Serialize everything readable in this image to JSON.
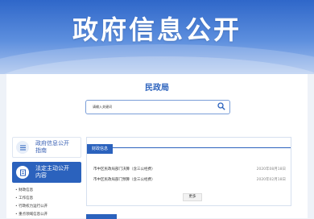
{
  "banner": {
    "title": "政府信息公开"
  },
  "department": {
    "name": "民政局"
  },
  "search": {
    "placeholder": "请输入关键词"
  },
  "sidebar": {
    "items": [
      {
        "label": "政府信息公开指南",
        "active": false
      },
      {
        "label": "法定主动公开内容",
        "active": true
      }
    ],
    "subitems": [
      "财政信息",
      "工作信息",
      "行政权力运行公开",
      "重点领域信息公开"
    ]
  },
  "content": {
    "tab": "财政信息",
    "rows": [
      {
        "title": "市中区民政局部门决算（含三公经费）",
        "date": "2020年08月18日"
      },
      {
        "title": "市中区民政局部门预算（含三公经费）",
        "date": "2020年02月18日"
      }
    ],
    "more_label": "更多"
  },
  "colors": {
    "accent": "#2b62bd",
    "banner": "#4a7fd6"
  }
}
